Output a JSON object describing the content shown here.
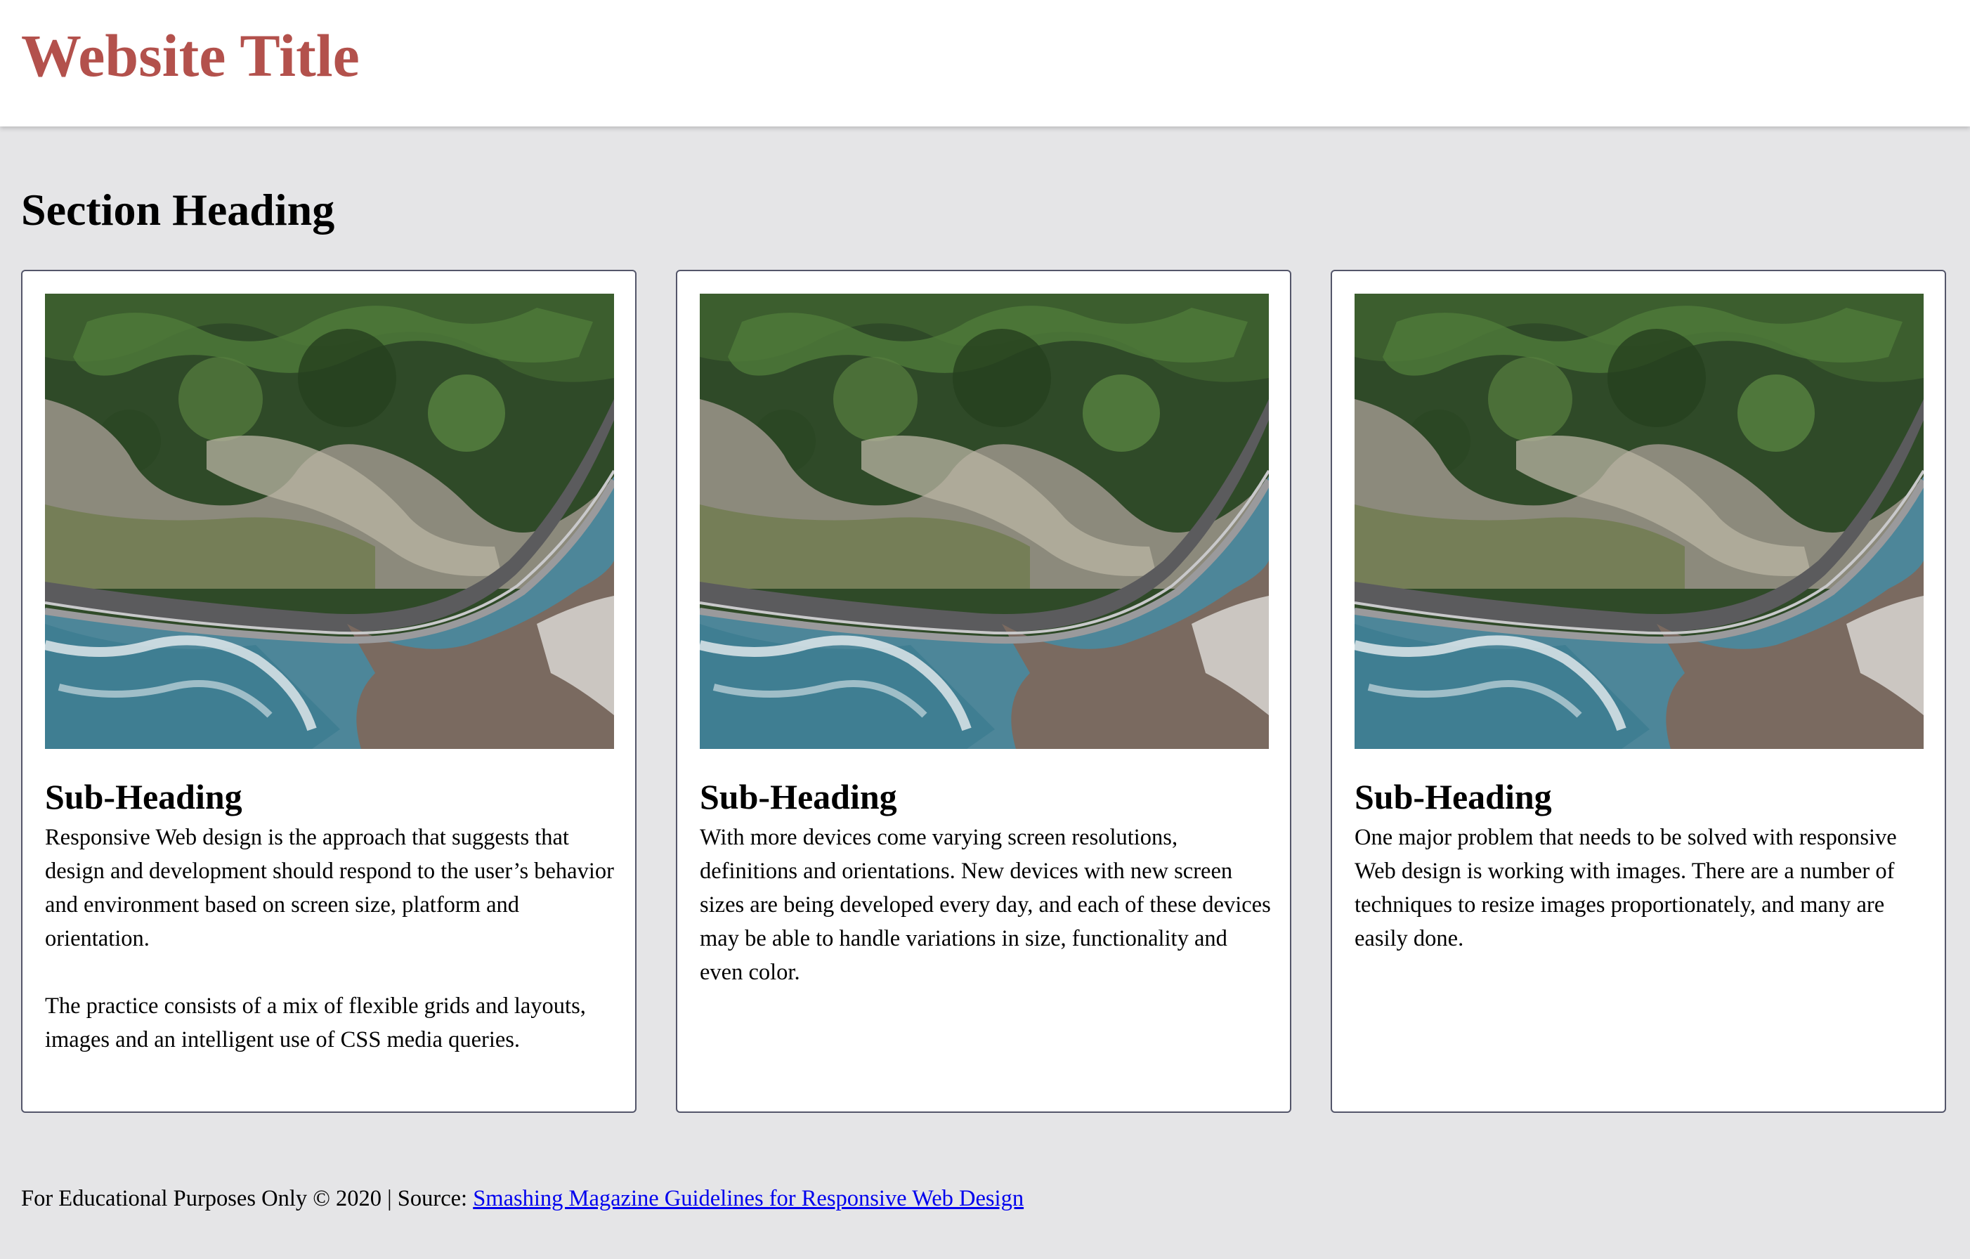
{
  "header": {
    "title": "Website Title"
  },
  "section": {
    "heading": "Section Heading"
  },
  "cards": [
    {
      "image_alt": "aerial-coastal-road-photo",
      "subheading": "Sub-Heading",
      "paragraphs": [
        "Responsive Web design is the approach that suggests that design and development should respond to the user’s behavior and environment based on screen size, platform and orientation.",
        "The practice consists of a mix of flexible grids and layouts, images and an intelligent use of CSS media queries."
      ]
    },
    {
      "image_alt": "aerial-coastal-road-photo",
      "subheading": "Sub-Heading",
      "paragraphs": [
        "With more devices come varying screen resolutions, definitions and orientations. New devices with new screen sizes are being developed every day, and each of these devices may be able to handle variations in size, functionality and even color."
      ]
    },
    {
      "image_alt": "aerial-coastal-road-photo",
      "subheading": "Sub-Heading",
      "paragraphs": [
        "One major problem that needs to be solved with responsive Web design is working with images. There are a number of techniques to resize images proportionately, and many are easily done."
      ]
    }
  ],
  "footer": {
    "text": "For Educational Purposes Only © 2020 | Source: ",
    "link_label": "Smashing Magazine Guidelines for Responsive Web Design"
  },
  "colors": {
    "title": "#b3514c",
    "background": "#e5e5e7",
    "card_border": "#54566a",
    "link": "#0000ee"
  }
}
